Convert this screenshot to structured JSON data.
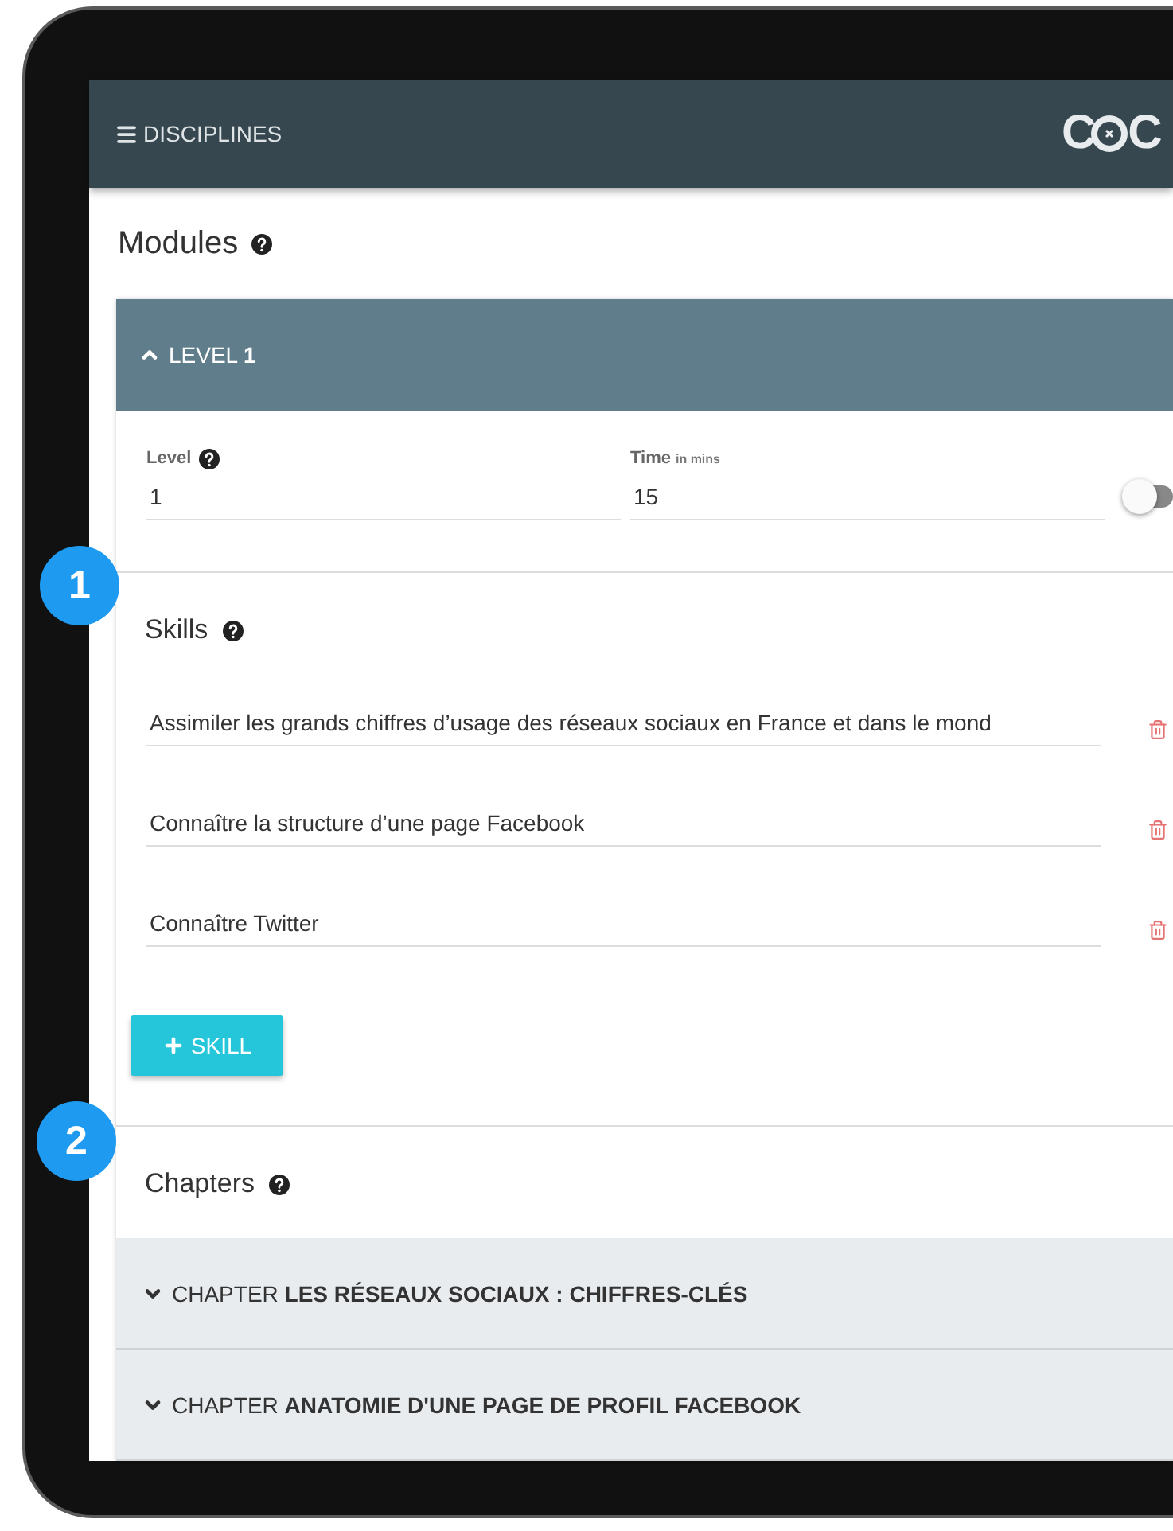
{
  "top_bar": {
    "menu_label": "DISCIPLINES",
    "logo": [
      "C",
      "C"
    ]
  },
  "page_title": "Modules",
  "page_title_help": true,
  "level_card": {
    "title": "LEVEL **1**",
    "expanded": true,
    "fields": [
      {
        "label": "Level",
        "help": true,
        "value": "1"
      },
      {
        "label": "Time",
        "unit": "in mins",
        "value": "15"
      }
    ],
    "toggle": {
      "on": false
    },
    "callout": "1",
    "skills": {
      "title": "Skills",
      "help": true,
      "items": [
        {
          "value": "Assimiler les grands chiffres d’usage des réseaux sociaux en France et dans le mond"
        },
        {
          "value": "Connaître la structure d’une page Facebook"
        },
        {
          "value": "Connaître Twitter"
        }
      ],
      "add_button": "SKILL"
    },
    "chapters": {
      "callout": "2",
      "title": "Chapters",
      "help": true,
      "items": [
        {
          "title": "CHAPTER **LES RÉSEAUX SOCIAUX : CHIFFRES-CLÉS**",
          "expanded": false
        },
        {
          "title": "CHAPTER **ANATOMIE D'UNE PAGE DE PROFIL FACEBOOK**",
          "expanded": false
        }
      ]
    }
  }
}
